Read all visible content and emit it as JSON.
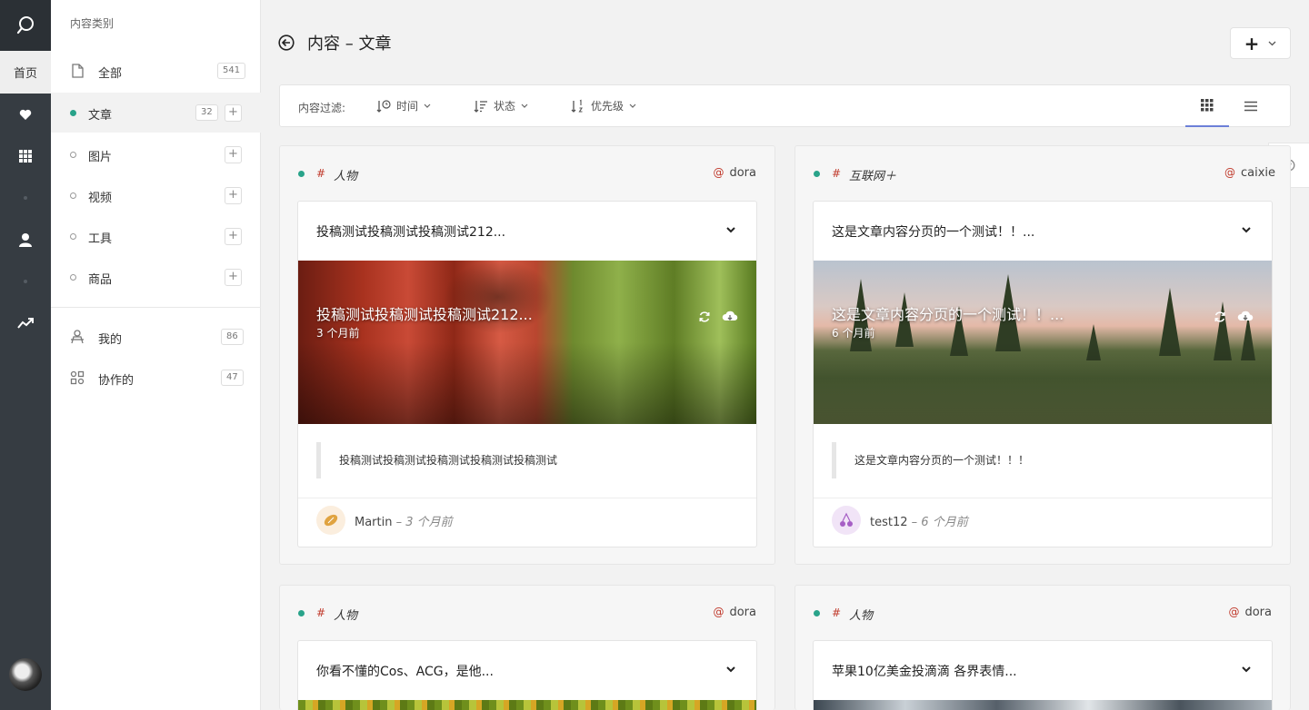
{
  "rail": {
    "home_label": "首页"
  },
  "sidebar": {
    "title": "内容类别",
    "all": {
      "label": "全部",
      "count": "541"
    },
    "types": [
      {
        "label": "文章",
        "count": "32"
      },
      {
        "label": "图片"
      },
      {
        "label": "视频"
      },
      {
        "label": "工具"
      },
      {
        "label": "商品"
      }
    ],
    "mine": {
      "label": "我的",
      "count": "86"
    },
    "collab": {
      "label": "协作的",
      "count": "47"
    }
  },
  "header": {
    "title": "内容 – 文章",
    "add_symbol": "+"
  },
  "filter": {
    "label": "内容过滤:",
    "options": [
      {
        "label": "时间"
      },
      {
        "label": "状态"
      },
      {
        "label": "优先级"
      }
    ]
  },
  "cards": [
    {
      "tag": "人物",
      "author": "dora",
      "title": "投稿测试投稿测试投稿测试212...",
      "overlay_title": "投稿测试投稿测试投稿测试212...",
      "overlay_time": "3 个月前",
      "excerpt": "投稿测试投稿测试投稿测试投稿测试投稿测试",
      "user": "Martin",
      "user_time": "– 3 个月前"
    },
    {
      "tag": "互联网＋",
      "author": "caixie",
      "title": "这是文章内容分页的一个测试！！...",
      "overlay_title": "这是文章内容分页的一个测试！！...",
      "overlay_time": "6 个月前",
      "excerpt": "这是文章内容分页的一个测试！！！",
      "user": "test12",
      "user_time": "– 6 个月前"
    },
    {
      "tag": "人物",
      "author": "dora",
      "title": "你看不懂的Cos、ACG，是他..."
    },
    {
      "tag": "人物",
      "author": "dora",
      "title": "苹果10亿美金投滴滴 各界表情..."
    }
  ],
  "colors": {
    "accent": "#29a38a",
    "rail": "#363c42",
    "tag_hash": "#c0392b",
    "view_active": "#6c7fd8"
  }
}
